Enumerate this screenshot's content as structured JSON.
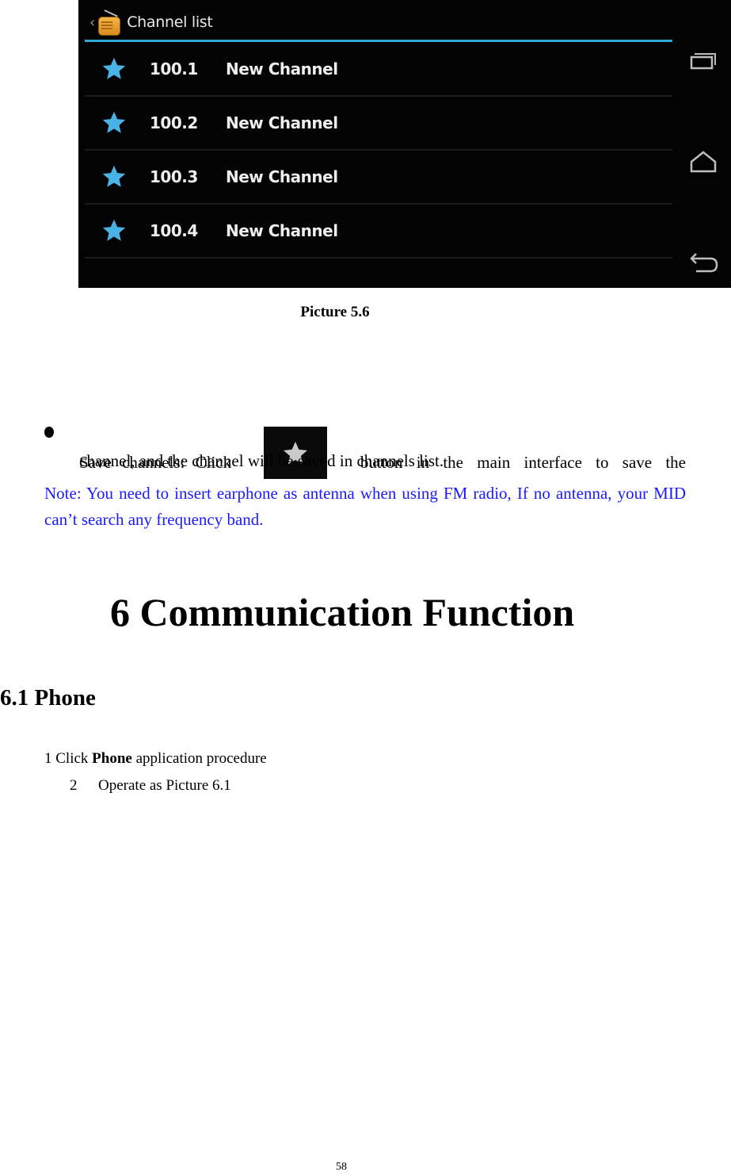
{
  "screenshot": {
    "back_glyph": "‹",
    "title": "Channel list",
    "accent_color": "#33a8d4",
    "star_color": "#4ab3e6",
    "channels": [
      {
        "frequency": "100.1",
        "name": "New Channel"
      },
      {
        "frequency": "100.2",
        "name": "New Channel"
      },
      {
        "frequency": "100.3",
        "name": "New Channel"
      },
      {
        "frequency": "100.4",
        "name": "New Channel"
      }
    ],
    "nav_buttons": [
      "recent-apps",
      "home",
      "back"
    ]
  },
  "caption": "Picture 5.6",
  "bullet": {
    "line1_before": "Save channels: Click",
    "line1_after": "button in the main interface to save the",
    "line2": "channel, and the channel will be saved in channels list.",
    "icon": "star-icon"
  },
  "note": "Note: You need to insert earphone as antenna when using FM radio, If no antenna, your MID can’t search any frequency band.",
  "chapter_heading": "6 Communication Function",
  "section_heading": "6.1 Phone",
  "steps": {
    "step1_prefix": "1 Click ",
    "step1_bold": "Phone",
    "step1_suffix": " application procedure",
    "step2_number": "2",
    "step2_text": "Operate as Picture 6.1"
  },
  "page_number": "58"
}
